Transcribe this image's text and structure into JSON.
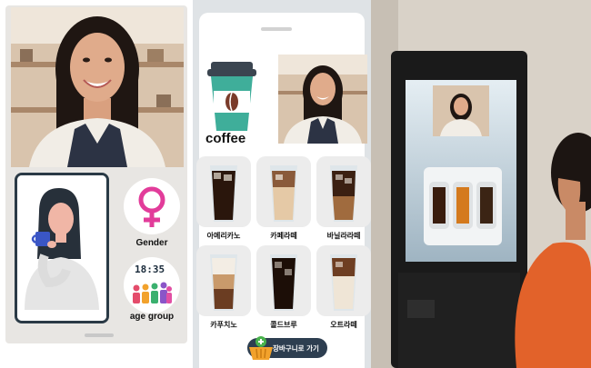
{
  "panel1": {
    "gender_label": "Gender",
    "age_label": "age group",
    "clock_text": "18:35",
    "colors": {
      "gender_symbol": "#e23c9a",
      "card_border": "#2a3a46"
    }
  },
  "panel2": {
    "category_title": "coffee",
    "menu": [
      {
        "name": "아메리카노",
        "drink": "americano-icon"
      },
      {
        "name": "카페라떼",
        "drink": "cafe-latte-icon"
      },
      {
        "name": "바닐라라떼",
        "drink": "vanilla-latte-icon"
      },
      {
        "name": "카푸치노",
        "drink": "cappuccino-icon"
      },
      {
        "name": "콜드브루",
        "drink": "cold-brew-icon"
      },
      {
        "name": "오트라떼",
        "drink": "oat-latte-icon"
      }
    ],
    "cart_button_label": "장바구니로 가기",
    "colors": {
      "cup_teal": "#3fae9a",
      "cup_lid": "#3b4550",
      "cart_button": "#2d3e50",
      "cart_plus": "#49b24c"
    }
  }
}
